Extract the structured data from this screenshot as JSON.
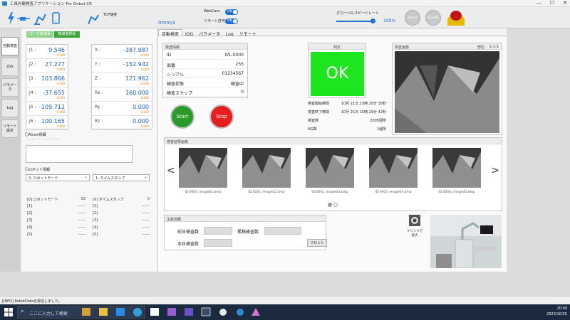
{
  "window": {
    "title": "工具外観検査アプリケーション For Dobot CR",
    "min": "—",
    "max": "☐",
    "close": "✕"
  },
  "toolbar": {
    "tcp_label": "TCP速度",
    "tcp_speed": "0mm/s",
    "webcam_label": "WebCam",
    "webcam_state": "ON",
    "remote_label": "リモート許可",
    "remote_state": "ON",
    "global_speed_label": "グローバルスピードレート",
    "global_speed": 1.0,
    "global_speed_text": "100%",
    "reset_label": "Reset",
    "enable_label": "Enable"
  },
  "sidenav": [
    "自動検査",
    "JOG",
    "パラメータ",
    "Log",
    "リモート設定"
  ],
  "left": {
    "tab_work": "ワーク座標系",
    "tab_machine": "機械座標系",
    "joints": [
      {
        "label": "J1 :",
        "value": "9.546",
        "sub": "0.000"
      },
      {
        "label": "J2 :",
        "value": "27.277",
        "sub": "0.000"
      },
      {
        "label": "J3 :",
        "value": "103.866",
        "sub": "0.000"
      },
      {
        "label": "J4 :",
        "value": "-37.655",
        "sub": "0.000"
      },
      {
        "label": "J5 :",
        "value": "-109.712",
        "sub": "0.000"
      },
      {
        "label": "J6 :",
        "value": "100.165",
        "sub": "0.000"
      }
    ],
    "coords": [
      {
        "label": "X :",
        "value": "-387.987",
        "sub": "0.000"
      },
      {
        "label": "Y :",
        "value": "-152.942",
        "sub": "0.000"
      },
      {
        "label": "Z :",
        "value": "121.962",
        "sub": "0.000"
      },
      {
        "label": "Rx :",
        "value": "160.000",
        "sub": "0.000"
      },
      {
        "label": "Ry :",
        "value": "0.000",
        "sub": "0.000"
      },
      {
        "label": "Rz :",
        "value": "0.000",
        "sub": "0.000"
      }
    ],
    "alarm_label": "〇Alram情報",
    "alarm_dashes": "- - - - - - - - - - - - - -",
    "robot_info_label": "〇ロボット情報",
    "select_mode": "0: ロボットモード",
    "select_ts": "1: タイムスタンプ",
    "log_left": [
      [
        "[0] ロボットモード",
        "03"
      ],
      [
        "[1]",
        "------"
      ],
      [
        "[2]",
        "------"
      ],
      [
        "[3]",
        "------"
      ],
      [
        "[4]",
        "------"
      ],
      [
        "[5]",
        "------"
      ]
    ],
    "log_right": [
      [
        "[0] タイムスタンプ",
        "0"
      ],
      [
        "[1]",
        "------"
      ],
      [
        "[2]",
        "------"
      ],
      [
        "[3]",
        "------"
      ],
      [
        "[4]",
        "------"
      ],
      [
        "[5]",
        "------"
      ]
    ]
  },
  "tabs": [
    "自動検査",
    "JOG",
    "パラメータ",
    "Log",
    "リモート"
  ],
  "inspection": {
    "title": "検査情報",
    "rows": [
      {
        "k": "ID",
        "v": "IVL-0000"
      },
      {
        "k": "品番",
        "v": "255"
      },
      {
        "k": "シリアル",
        "v": "01234567"
      },
      {
        "k": "検査状態",
        "v": "検査中"
      },
      {
        "k": "検査ステップ",
        "v": "0"
      }
    ]
  },
  "judge": {
    "title": "判定",
    "result": "OK",
    "rows": [
      {
        "k": "検査開始時間",
        "v": "10月 21日 15時 20分 35秒"
      },
      {
        "k": "検査終了時間",
        "v": "10月 21日 15時 25分 42秒"
      },
      {
        "k": "検査数",
        "v": "2005個所"
      },
      {
        "k": "NG数",
        "v": "1個所"
      }
    ]
  },
  "start_label": "Start",
  "stop_label": "Stop",
  "image": {
    "title": "検査画像",
    "part_label": "部位",
    "part_value": "L-1-1"
  },
  "results": {
    "title": "検査結果画像",
    "prev": "<",
    "next": ">",
    "captions": [
      "ID:0000_image01.bmp",
      "ID:0001_image02.bmp",
      "ID:0002_image03.bmp",
      "ID:0003_image04.bmp",
      "ID:0004_image05.bmp"
    ]
  },
  "production": {
    "title": "生産情報",
    "prev_day": "前日検査数",
    "cumulative": "累積検査数",
    "today": "本日検査数",
    "reset": "リセット"
  },
  "zoom_label": "クリックで\n拡大",
  "status": "[INFO] RobotDataを受信しました。",
  "taskbar": {
    "search": "ここに入力して検索",
    "time": "20:09",
    "date": "2023/10/25"
  },
  "colors": {
    "ok_green": "#1ee61e",
    "start_green": "#2a9a2a",
    "stop_red": "#e61e1e",
    "accent_blue": "#1f6fd6"
  }
}
